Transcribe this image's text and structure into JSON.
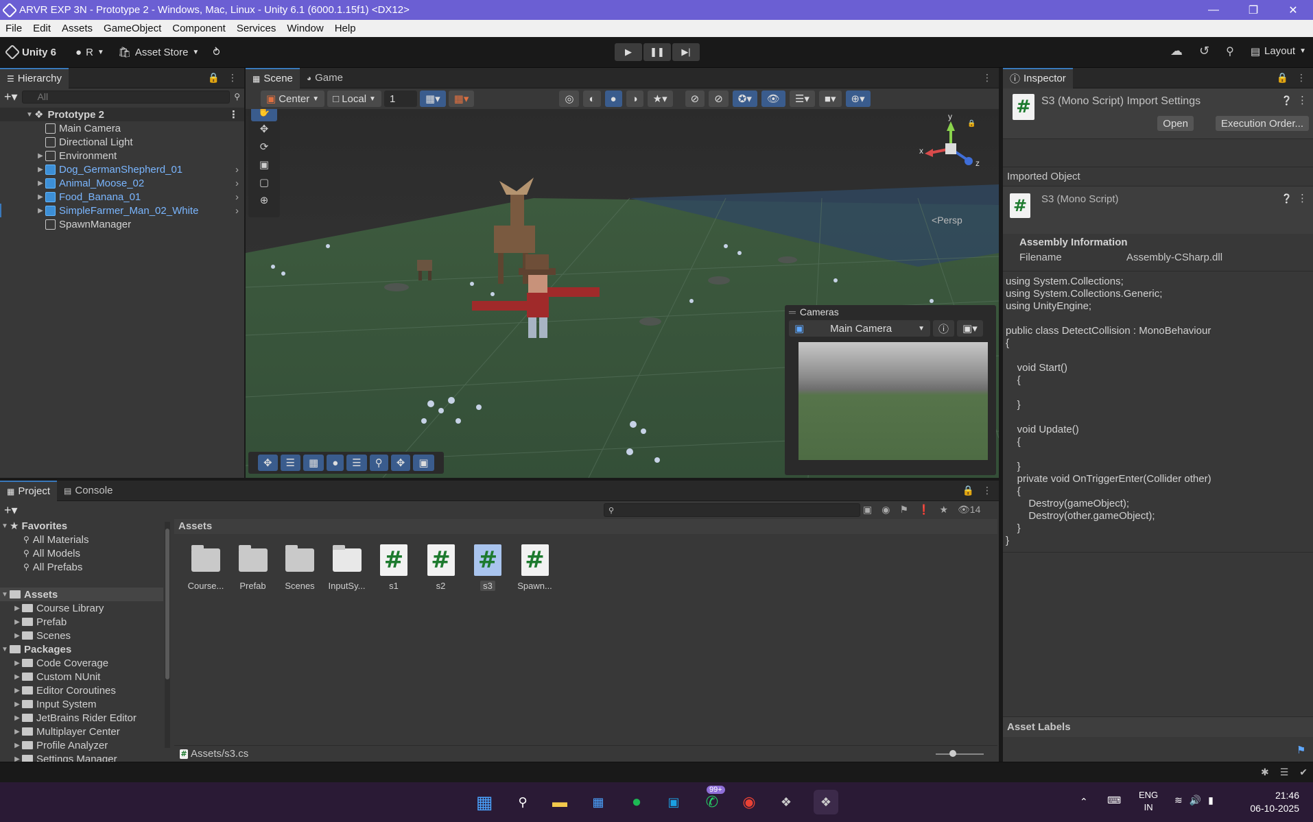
{
  "window": {
    "title": "ARVR EXP 3N - Prototype 2 - Windows, Mac, Linux - Unity 6.1 (6000.1.15f1) <DX12>"
  },
  "menu": [
    "File",
    "Edit",
    "Assets",
    "GameObject",
    "Component",
    "Services",
    "Window",
    "Help"
  ],
  "toolbar": {
    "unity": "Unity 6",
    "account": "R",
    "asset_store": "Asset Store",
    "layout": "Layout"
  },
  "hierarchy": {
    "tab": "Hierarchy",
    "search_placeholder": "All",
    "scene": "Prototype 2",
    "items": [
      {
        "label": "Main Camera",
        "prefab": false,
        "expand": false
      },
      {
        "label": "Directional Light",
        "prefab": false,
        "expand": false
      },
      {
        "label": "Environment",
        "prefab": false,
        "expand": true
      },
      {
        "label": "Dog_GermanShepherd_01",
        "prefab": true,
        "expand": true
      },
      {
        "label": "Animal_Moose_02",
        "prefab": true,
        "expand": true
      },
      {
        "label": "Food_Banana_01",
        "prefab": true,
        "expand": true
      },
      {
        "label": "SimpleFarmer_Man_02_White",
        "prefab": true,
        "expand": true
      },
      {
        "label": "SpawnManager",
        "prefab": false,
        "expand": false
      }
    ]
  },
  "scene": {
    "tabs": [
      "Scene",
      "Game"
    ],
    "pivot": "Center",
    "space": "Local",
    "grid_snap": "1",
    "persp": "Persp",
    "gizmo_axes": {
      "x": "x",
      "y": "y",
      "z": "z"
    },
    "cameras_overlay": {
      "title": "Cameras",
      "camera": "Main Camera"
    }
  },
  "inspector": {
    "tab": "Inspector",
    "title": "S3 (Mono Script) Import Settings",
    "open": "Open",
    "execution_order": "Execution Order...",
    "imported_object": "Imported Object",
    "object_title": "S3 (Mono Script)",
    "assembly_header": "Assembly Information",
    "filename_label": "Filename",
    "filename_value": "Assembly-CSharp.dll",
    "code": "using System.Collections;\nusing System.Collections.Generic;\nusing UnityEngine;\n\npublic class DetectCollision : MonoBehaviour\n{\n\n    void Start()\n    {\n\n    }\n\n    void Update()\n    {\n\n    }\n    private void OnTriggerEnter(Collider other)\n    {\n        Destroy(gameObject);\n        Destroy(other.gameObject);\n    }\n}",
    "asset_labels": "Asset Labels"
  },
  "project": {
    "tabs": [
      "Project",
      "Console"
    ],
    "hidden_count": "14",
    "favorites": {
      "label": "Favorites",
      "items": [
        "All Materials",
        "All Models",
        "All Prefabs"
      ]
    },
    "assets_root": {
      "label": "Assets",
      "items": [
        "Course Library",
        "Prefab",
        "Scenes"
      ]
    },
    "packages": {
      "label": "Packages",
      "items": [
        "Code Coverage",
        "Custom NUnit",
        "Editor Coroutines",
        "Input System",
        "JetBrains Rider Editor",
        "Multiplayer Center",
        "Profile Analyzer",
        "Settings Manager"
      ]
    },
    "breadcrumb": "Assets",
    "grid": [
      {
        "label": "Course...",
        "kind": "folder"
      },
      {
        "label": "Prefab",
        "kind": "folder"
      },
      {
        "label": "Scenes",
        "kind": "folder"
      },
      {
        "label": "InputSy...",
        "kind": "input"
      },
      {
        "label": "s1",
        "kind": "script"
      },
      {
        "label": "s2",
        "kind": "script"
      },
      {
        "label": "s3",
        "kind": "script",
        "selected": true
      },
      {
        "label": "Spawn...",
        "kind": "script"
      }
    ],
    "path": "Assets/s3.cs"
  },
  "taskbar": {
    "badge": "99+",
    "lang1": "ENG",
    "lang2": "IN",
    "time": "21:46",
    "date": "06-10-2025"
  },
  "colors": {
    "title_bg": "#6b5fd3",
    "accent": "#3a79bb",
    "prefab_blue": "#7ab6ff",
    "script_green": "#1d7a2e"
  }
}
